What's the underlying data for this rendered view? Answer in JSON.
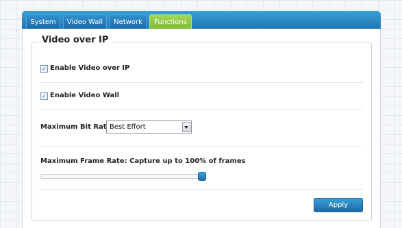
{
  "tabs": [
    {
      "label": "System",
      "active": false
    },
    {
      "label": "Video Wall",
      "active": false
    },
    {
      "label": "Network",
      "active": false
    },
    {
      "label": "Functions",
      "active": true
    }
  ],
  "panel": {
    "legend": "Video over IP",
    "enable_video_over_ip": {
      "label": "Enable Video over IP",
      "checked": true
    },
    "enable_video_wall": {
      "label": "Enable Video Wall",
      "checked": true
    },
    "max_bit_rate": {
      "label": "Maximum Bit Rate:",
      "value": "Best Effort"
    },
    "max_frame_rate": {
      "label": "Maximum Frame Rate: Capture up to 100% of frames",
      "percent": 100
    },
    "apply_label": "Apply"
  },
  "colors": {
    "tab_bar": "#1d78b8",
    "active_tab": "#7dbd31",
    "apply_button": "#2a86c4"
  }
}
